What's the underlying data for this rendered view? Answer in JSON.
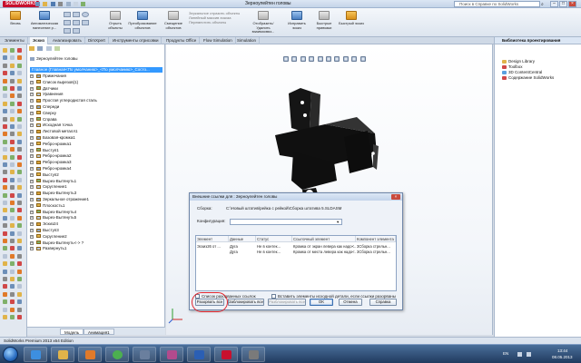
{
  "app": {
    "brand": "SOLIDWORKS",
    "doc_title": "Зерноулейтен головы",
    "search_placeholder": "Поиск в Справке по SolidWorks",
    "win_min": "–",
    "win_max": "□",
    "win_close": "×"
  },
  "ribbon": {
    "buttons": [
      "Вновь",
      "Автоматическая нанесение р...",
      "Отрыть объекты",
      "Преобразование объектов",
      "Смещение объектов",
      "Отобразить/Удалить взаимосвяз...",
      "Исправить эскиз",
      "Быстрые привязки",
      "Быстрый эскиз"
    ],
    "small_items": [
      "Зеркальное отразить объекты",
      "Линейный массив эскиза",
      "Переместить объекты"
    ]
  },
  "tabs": [
    "Элементы",
    "Эскиз",
    "Анализировать",
    "DimXpert",
    "Инструменты отрисовки",
    "Продукты Office",
    "Flow Simulation",
    "Simulation"
  ],
  "tree": {
    "header": "Зерноулейтен головы",
    "root": "Главное (Главная<По умолчанию>_<По умолчанию>_Состо...",
    "items": [
      "Примечания",
      "Список вырезов(1)",
      "Датчики",
      "Уравнения",
      "Простая углеродистая сталь",
      "Спереди",
      "Сверху",
      "Справа",
      "Исходная точка",
      "Листовой металл1",
      "Базовая-кромка1",
      "Ребро-кромка1",
      "Выступ1",
      "Ребро-кромка2",
      "Ребро-кромка3",
      "Ребро-кромка4",
      "Выступ2",
      "Вырез-Вытянуть1",
      "Скругление1",
      "Вырез-Вытянуть3",
      "Зеркальное отражение1",
      "Плоскость1",
      "Вырез-Вытянуть4",
      "Вырез-Вытянуть5",
      "Эскиз24",
      "Выступ3",
      "Скругление2",
      "Вырез-Вытянуть<-> ?",
      "Развернуть1"
    ],
    "bottom_tabs": [
      "Модель",
      "Анимация1"
    ]
  },
  "taskpane": {
    "title": "Библиотека проектирования",
    "items": [
      "Design Library",
      "Toolbox",
      "3D ContentCentral",
      "Содержание SolidWorks"
    ]
  },
  "dialog": {
    "title": "Внешние ссылки для : Зерноулейтен головы",
    "close": "×",
    "assembly_label": "Сборка:",
    "assembly_path": "C:\\Новый штатив\\рейка с рейкой\\Сборка штатива 5.SLDASM",
    "config_label": "Конфигурация:",
    "config_value": "",
    "columns": [
      "Элемент",
      "Данные",
      "Статус",
      "Ссылочный элемент",
      "Компонент элемента"
    ],
    "rows": [
      [
        "Эскиз26 от ...",
        "Дуга",
        "Не в контек...",
        "Кромка от экран левера как надо<...",
        "3Сборка стрельн..."
      ],
      [
        "",
        "Дуга",
        "Не в контек...",
        "Кромка от места левера как надо<...",
        "3Сборка стрельн..."
      ]
    ],
    "checkbox_broken": "Список разорванных ссылок",
    "checkbox_insert": "Вставить элементы исходной детали, если ссылки разорваны",
    "buttons": {
      "break_all": "Разорвать все",
      "lock_all": "Заблокировать все",
      "unlock_all": "Разблокировать все",
      "ok": "OK",
      "cancel": "Отмена",
      "help": "Справка"
    }
  },
  "statusbar": {
    "text": "SolidWorks Premium 2013 x64 Edition"
  },
  "taskbar": {
    "lang": "EN",
    "time": "13:44",
    "date": "08.05.2013"
  },
  "colors": {
    "accent": "#3399ff",
    "highlight_circle": "#e0252d",
    "brand": "#c8102e"
  }
}
